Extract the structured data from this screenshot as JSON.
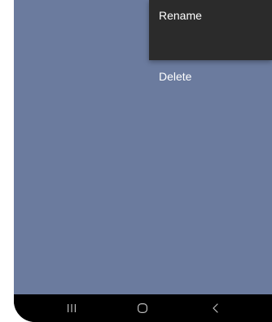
{
  "menu": {
    "items": [
      {
        "label": "Rename"
      },
      {
        "label": "Delete"
      }
    ]
  },
  "navbar": {
    "recent_icon": "recent-apps-icon",
    "home_icon": "home-icon",
    "back_icon": "back-icon"
  },
  "colors": {
    "content_bg": "#6b7b9e",
    "menu_bg": "#2b2b2b",
    "navbar_bg": "#000000"
  }
}
